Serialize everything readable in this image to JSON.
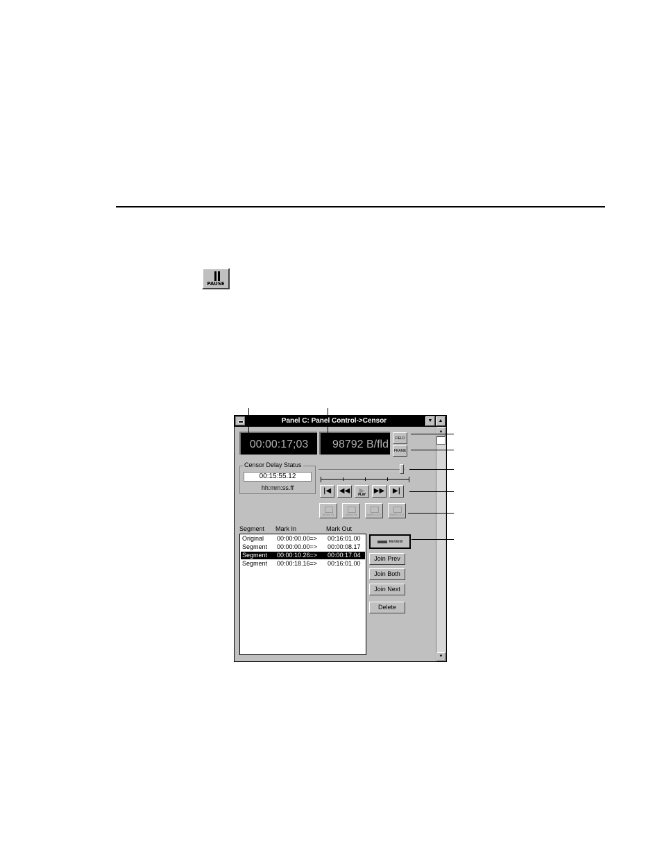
{
  "pause_button": {
    "label": "PAUSE"
  },
  "window": {
    "title": "Panel C: Panel Control->Censor",
    "time_display": "00:00:17;03",
    "rate_display": "98792 B/fld",
    "side_buttons": [
      "FIELD",
      "FRAME"
    ],
    "censor_delay": {
      "label": "Censor Delay Status",
      "value": "00:15:55.12",
      "format": "hh:mm:ss.ff"
    },
    "transport": [
      {
        "name": "go-to-start",
        "glyph": "|◀"
      },
      {
        "name": "rewind",
        "glyph": "◀◀"
      },
      {
        "name": "play",
        "glyph": "▶",
        "label": "PLAY"
      },
      {
        "name": "fast-forward",
        "glyph": "▶▶"
      },
      {
        "name": "go-to-end",
        "glyph": "▶|"
      }
    ],
    "edit_buttons": [
      "MARK IN",
      "MARK IN",
      "MARK OUT",
      "MARK OUT"
    ],
    "segments": {
      "headers": [
        "Segment",
        "Mark In",
        "Mark Out"
      ],
      "rows": [
        {
          "segment": "Original",
          "mark_in": "00:00:00.00=>",
          "mark_out": "00:16:01.00",
          "selected": false
        },
        {
          "segment": "Segment",
          "mark_in": "00:00:00.00=>",
          "mark_out": "00:00:08.17",
          "selected": false
        },
        {
          "segment": "Segment",
          "mark_in": "00:00:10.26=>",
          "mark_out": "00:00:17.04",
          "selected": true
        },
        {
          "segment": "Segment",
          "mark_in": "00:00:18.16=>",
          "mark_out": "00:16:01.00",
          "selected": false
        }
      ]
    },
    "actions": {
      "review": "REVIEW",
      "join_prev": "Join Prev",
      "join_both": "Join Both",
      "join_next": "Join Next",
      "delete": "Delete"
    }
  }
}
